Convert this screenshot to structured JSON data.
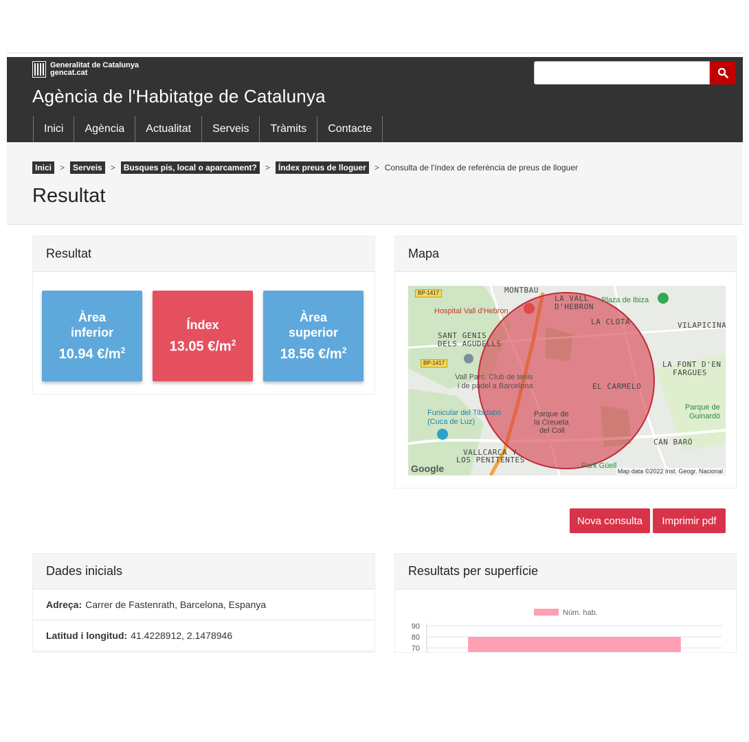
{
  "header": {
    "brand_line1": "Generalitat de Catalunya",
    "brand_line2": "gencat.cat",
    "site_title": "Agència de l'Habitatge de Catalunya",
    "search_placeholder": "",
    "search_icon": "search-icon",
    "nav": [
      "Inici",
      "Agència",
      "Actualitat",
      "Serveis",
      "Tràmits",
      "Contacte"
    ]
  },
  "breadcrumb": {
    "links": [
      "Inici",
      "Serveis",
      "Busques pis, local o aparcament?",
      "Índex preus de lloguer"
    ],
    "separator": ">",
    "current": "Consulta de l'índex de referència de preus de lloguer"
  },
  "page_title": "Resultat",
  "result_panel": {
    "title": "Resultat",
    "cards": [
      {
        "label": "Àrea inferior",
        "value": "10.94 €/m",
        "unit_exp": "2",
        "color": "#5ea8dc"
      },
      {
        "label": "Índex",
        "value": "13.05 €/m",
        "unit_exp": "2",
        "color": "#e5505f"
      },
      {
        "label": "Àrea superior",
        "value": "18.56 €/m",
        "unit_exp": "2",
        "color": "#5ea8dc"
      }
    ]
  },
  "map_panel": {
    "title": "Mapa",
    "labels": {
      "montbau": "MONTBAU",
      "la_vall_1": "LA VALL",
      "la_vall_2": "D'HEBRON",
      "plaza_ibiza": "Plaza de Ibiza",
      "hospital": "Hospital Vall d'Hebron",
      "la_clota": "LA CLOTA",
      "vilapicina": "VILAPICINA",
      "sant_genis_1": "SANT GENIS",
      "sant_genis_2": "DELS AGUDELLS",
      "font_1": "LA FONT D'EN",
      "font_2": "FARGUES",
      "vall_parc_1": "Vall Parc. Club de tenis",
      "vall_parc_2": "i de pàdel a Barcelona",
      "el_carmelo": "EL CARMELO",
      "funicular_1": "Funicular del Tibidabo",
      "funicular_2": "(Cuca de Luz)",
      "creueta_1": "Parque de",
      "creueta_2": "la Creueta",
      "creueta_3": "del Coll",
      "guinardo_1": "Parque de",
      "guinardo_2": "Guinardó",
      "can_baro": "CAN BARÓ",
      "vallcarca_1": "VALLCARCA Y",
      "vallcarca_2": "LOS PENITENTES",
      "park_guell": "Park Güell",
      "road1": "BP-1417",
      "road2": "BP-1417",
      "google": "Google",
      "attribution": "Map data ©2022 Inst. Geogr. Nacional"
    },
    "circle_color": "#d9434f"
  },
  "actions": {
    "nova_consulta": "Nova consulta",
    "imprimir_pdf": "Imprimir pdf"
  },
  "initial_data": {
    "title": "Dades inicials",
    "address_label": "Adreça:",
    "address_value": "Carrer de Fastenrath, Barcelona, Espanya",
    "latlng_label": "Latitud i longitud:",
    "latlng_value": "41.4228912, 2.1478946"
  },
  "surface_panel": {
    "title": "Resultats per superfície"
  },
  "chart_data": {
    "type": "bar",
    "legend": [
      "Núm. hab."
    ],
    "legend_color": "#ff9fb3",
    "y_ticks": [
      90,
      80,
      70
    ],
    "ylim": [
      70,
      90
    ],
    "series": [
      {
        "name": "Núm. hab.",
        "values": [
          80
        ]
      }
    ],
    "categories": [
      ""
    ]
  }
}
